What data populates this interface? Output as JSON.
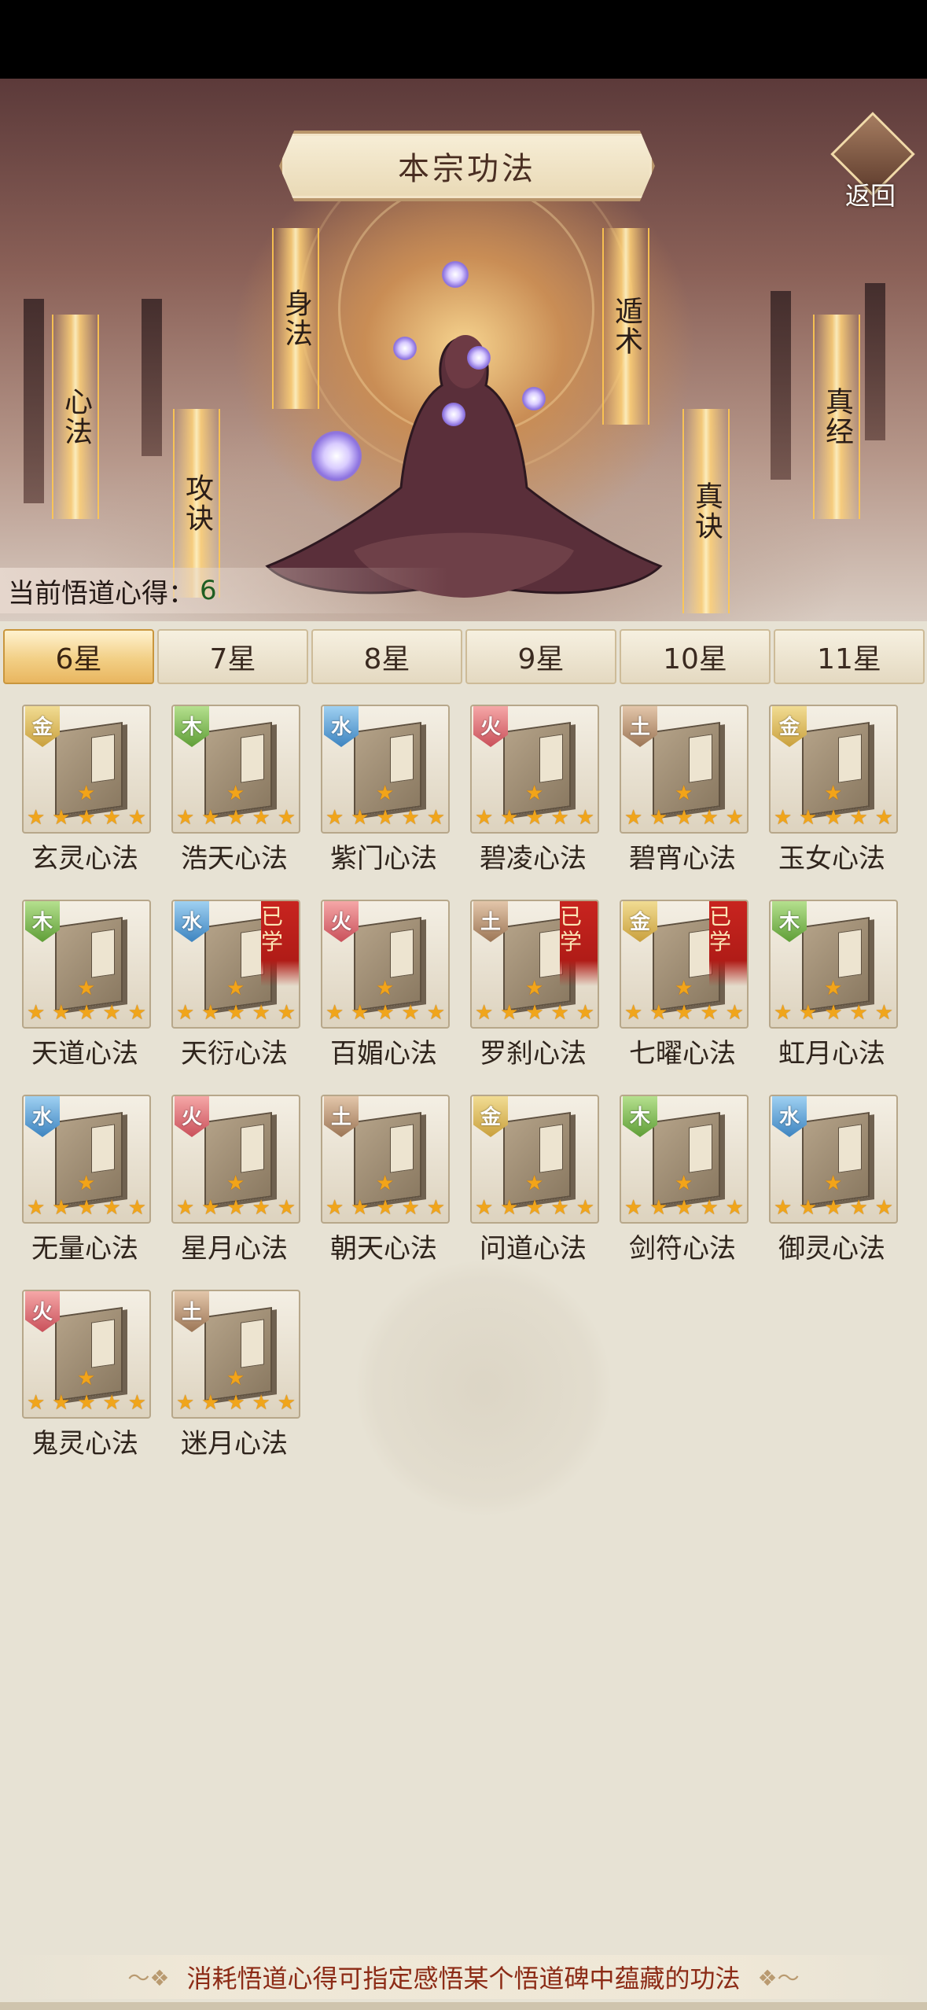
{
  "header": {
    "title": "本宗功法",
    "back_label": "返回"
  },
  "skill_tags": {
    "xinfa": "心法",
    "shenfa": "身法",
    "gongjue": "攻诀",
    "dunshu": "遁术",
    "zhenjue": "真诀",
    "zhenjing": "真经"
  },
  "insight": {
    "label": "当前悟道心得：",
    "value": "6"
  },
  "tabs": [
    {
      "label": "6星",
      "active": true
    },
    {
      "label": "7星",
      "active": false
    },
    {
      "label": "8星",
      "active": false
    },
    {
      "label": "9星",
      "active": false
    },
    {
      "label": "10星",
      "active": false
    },
    {
      "label": "11星",
      "active": false
    }
  ],
  "learned_label": "已学",
  "items": [
    {
      "name": "玄灵心法",
      "element": "金",
      "learned": false
    },
    {
      "name": "浩天心法",
      "element": "木",
      "learned": false
    },
    {
      "name": "紫门心法",
      "element": "水",
      "learned": false
    },
    {
      "name": "碧凌心法",
      "element": "火",
      "learned": false
    },
    {
      "name": "碧宵心法",
      "element": "土",
      "learned": false
    },
    {
      "name": "玉女心法",
      "element": "金",
      "learned": false
    },
    {
      "name": "天道心法",
      "element": "木",
      "learned": false
    },
    {
      "name": "天衍心法",
      "element": "水",
      "learned": true
    },
    {
      "name": "百媚心法",
      "element": "火",
      "learned": false
    },
    {
      "name": "罗刹心法",
      "element": "土",
      "learned": true
    },
    {
      "name": "七曜心法",
      "element": "金",
      "learned": true
    },
    {
      "name": "虹月心法",
      "element": "木",
      "learned": false
    },
    {
      "name": "无量心法",
      "element": "水",
      "learned": false
    },
    {
      "name": "星月心法",
      "element": "火",
      "learned": false
    },
    {
      "name": "朝天心法",
      "element": "土",
      "learned": false
    },
    {
      "name": "问道心法",
      "element": "金",
      "learned": false
    },
    {
      "name": "剑符心法",
      "element": "木",
      "learned": false
    },
    {
      "name": "御灵心法",
      "element": "水",
      "learned": false
    },
    {
      "name": "鬼灵心法",
      "element": "火",
      "learned": false
    },
    {
      "name": "迷月心法",
      "element": "土",
      "learned": false
    }
  ],
  "star_rating": 5,
  "footer": {
    "hint": "消耗悟道心得可指定感悟某个悟道碑中蕴藏的功法"
  }
}
